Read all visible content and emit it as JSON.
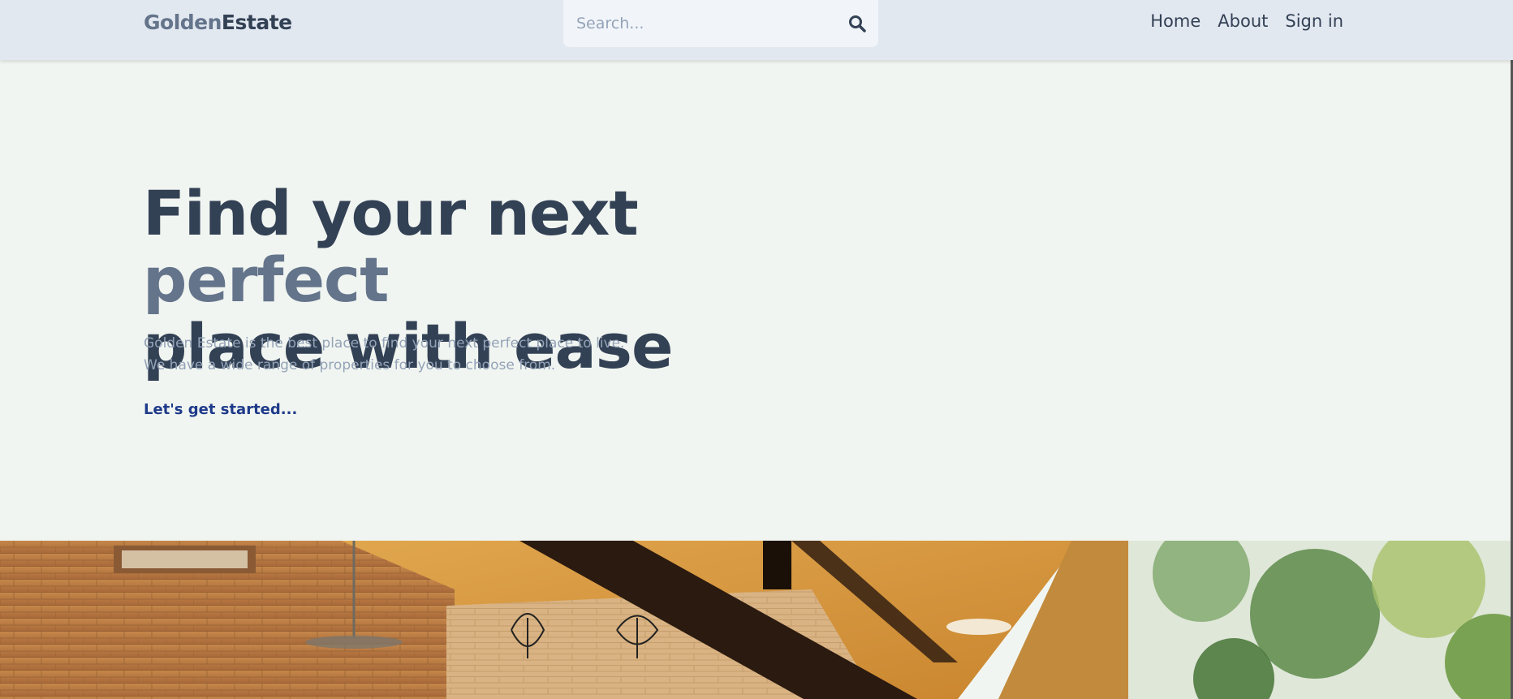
{
  "header": {
    "logo_part1": "Golden",
    "logo_part2": "Estate",
    "search_placeholder": "Search...",
    "search_icon": "search-icon",
    "nav": [
      "Home",
      "About",
      "Sign in"
    ]
  },
  "hero": {
    "title_part1": "Find your next ",
    "title_accent": "perfect",
    "title_part2": "place with ease",
    "subtitle_line1": "Golden Estate is the best place to find your next perfect place to live.",
    "subtitle_line2": "We have a wide range of properties for you to choose from.",
    "cta": "Let's get started..."
  },
  "colors": {
    "header_bg": "#e2e8f0",
    "page_bg": "#f1f5f1",
    "title_dark": "#334155",
    "title_accent": "#64748b",
    "cta": "#1e3a8a"
  }
}
